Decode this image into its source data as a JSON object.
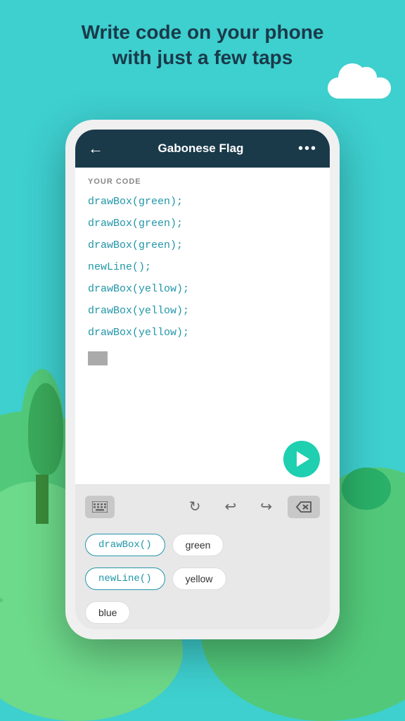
{
  "headline": {
    "line1": "Write code on your phone",
    "line2": "with just a few taps"
  },
  "app": {
    "header": {
      "title": "Gabonese Flag",
      "back_label": "←",
      "more_label": "•••"
    },
    "code_label": "YOUR CODE",
    "code_lines": [
      "drawBox(green);",
      "drawBox(green);",
      "drawBox(green);",
      "newLine();",
      "drawBox(yellow);",
      "drawBox(yellow);",
      "drawBox(yellow);"
    ]
  },
  "toolbar": {
    "keyboard_label": "keyboard",
    "refresh_label": "↻",
    "undo_label": "↩",
    "redo_label": "↪",
    "delete_label": "⌫"
  },
  "chips": {
    "row1": [
      "drawBox()",
      "green"
    ],
    "row2": [
      "newLine()",
      "yellow"
    ],
    "row3": [
      "blue"
    ]
  }
}
